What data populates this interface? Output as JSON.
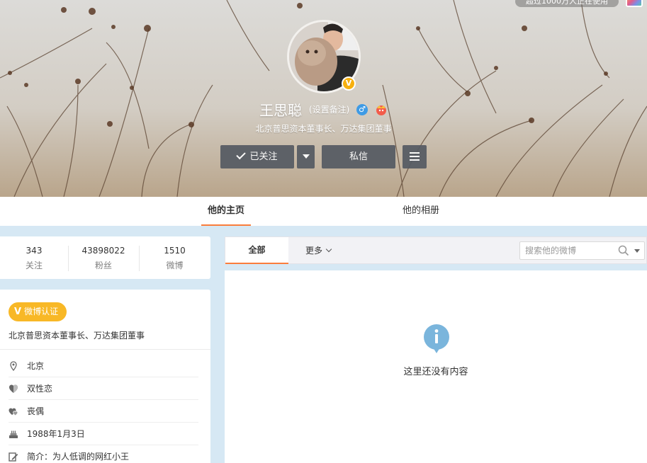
{
  "header": {
    "top_notice": "超过1000万人正在使用",
    "name": "王思聪",
    "remark": "(设置备注)",
    "verify_badge": "V",
    "gender_icon": "male-icon",
    "gender_symbol": "♂",
    "member_icon": "vip-crown-icon",
    "bio": "北京普思资本董事长、万达集团董事",
    "buttons": {
      "follow": "已关注",
      "message": "私信"
    }
  },
  "tabs": {
    "home": "他的主页",
    "album": "他的相册"
  },
  "stats": [
    {
      "value": "343",
      "label": "关注"
    },
    {
      "value": "43898022",
      "label": "粉丝"
    },
    {
      "value": "1510",
      "label": "微博"
    }
  ],
  "info": {
    "verify_tag": "微博认证",
    "verify_mark": "V",
    "verify_desc": "北京普思资本董事长、万达集团董事",
    "rows": [
      {
        "icon": "location-pin-icon",
        "text": "北京"
      },
      {
        "icon": "heart-shield-icon",
        "text": "双性恋"
      },
      {
        "icon": "broken-heart-icon",
        "text": "丧偶"
      },
      {
        "icon": "birthday-cake-icon",
        "text": "1988年1月3日"
      },
      {
        "icon": "edit-note-icon",
        "text": "简介：为人低调的网红小王"
      }
    ]
  },
  "feed": {
    "tab_all": "全部",
    "tab_more": "更多",
    "search_placeholder": "搜索他的微博",
    "empty_text": "这里还没有内容"
  },
  "colors": {
    "accent": "#fa7d3c",
    "verify_yellow": "#f8b826",
    "button_gray": "#565b63",
    "info_icon_blue": "#7ab5dc",
    "page_blue": "#d6e8f4"
  }
}
